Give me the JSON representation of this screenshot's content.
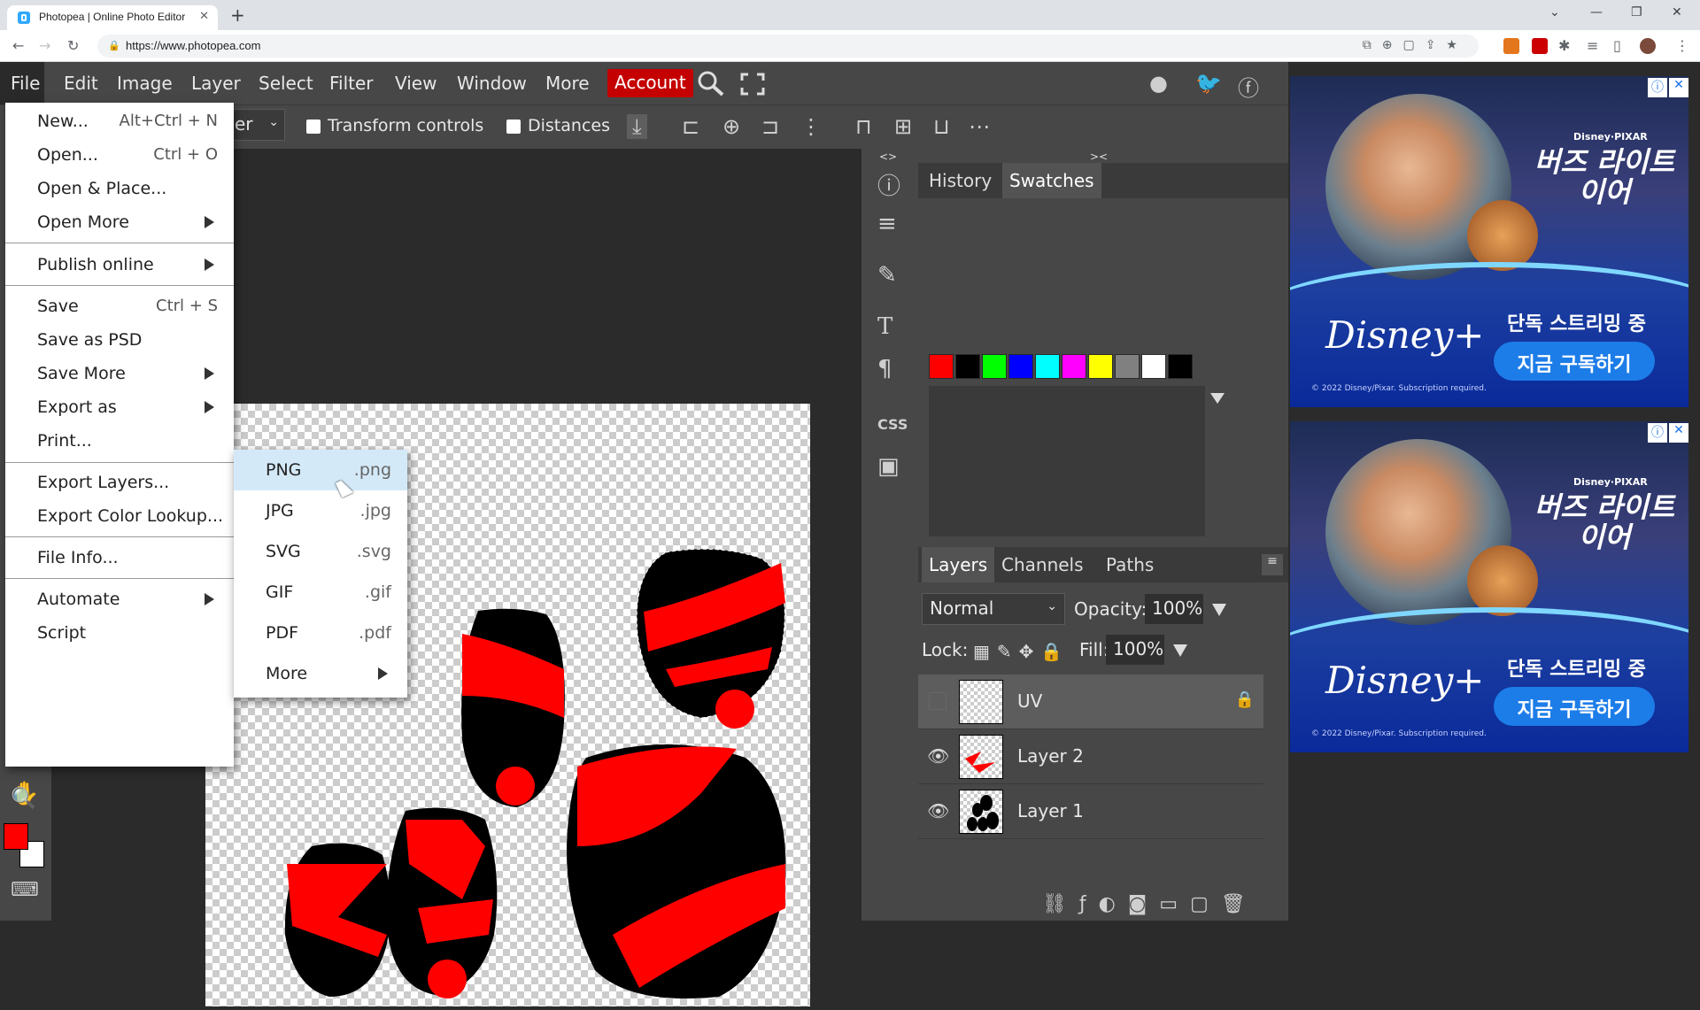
{
  "browser": {
    "tab_title": "Photopea | Online Photo Editor",
    "tab_close": "✕",
    "new_tab": "+",
    "url": "https://www.photopea.com",
    "window_controls": [
      "⌄",
      "—",
      "❐",
      "✕"
    ]
  },
  "menubar": {
    "items": [
      "File",
      "Edit",
      "Image",
      "Layer",
      "Select",
      "Filter",
      "View",
      "Window",
      "More"
    ],
    "account": "Account"
  },
  "options": {
    "select_text": "er",
    "transform_controls": "Transform controls",
    "distances": "Distances"
  },
  "file_menu": {
    "items": [
      {
        "label": "New...",
        "shortcut": "Alt+Ctrl + N"
      },
      {
        "label": "Open...",
        "shortcut": "Ctrl + O"
      },
      {
        "label": "Open & Place...",
        "shortcut": ""
      },
      {
        "label": "Open More",
        "shortcut": ""
      },
      {
        "label": "Publish online",
        "shortcut": ""
      },
      {
        "label": "Save",
        "shortcut": "Ctrl + S"
      },
      {
        "label": "Save as PSD",
        "shortcut": ""
      },
      {
        "label": "Save More",
        "shortcut": ""
      },
      {
        "label": "Export as",
        "shortcut": ""
      },
      {
        "label": "Print...",
        "shortcut": ""
      },
      {
        "label": "Export Layers...",
        "shortcut": ""
      },
      {
        "label": "Export Color Lookup...",
        "shortcut": ""
      },
      {
        "label": "File Info...",
        "shortcut": ""
      },
      {
        "label": "Automate",
        "shortcut": ""
      },
      {
        "label": "Script",
        "shortcut": ""
      }
    ]
  },
  "export_submenu": {
    "items": [
      {
        "name": "PNG",
        "ext": ".png"
      },
      {
        "name": "JPG",
        "ext": ".jpg"
      },
      {
        "name": "SVG",
        "ext": ".svg"
      },
      {
        "name": "GIF",
        "ext": ".gif"
      },
      {
        "name": "PDF",
        "ext": ".pdf"
      },
      {
        "name": "More",
        "ext": ""
      }
    ]
  },
  "panels": {
    "top_tabs": [
      "History",
      "Swatches"
    ],
    "swatch_colors": [
      "#ff0000",
      "#000000",
      "#00ff00",
      "#0000ff",
      "#00ffff",
      "#ff00ff",
      "#ffff00",
      "#808080",
      "#ffffff",
      "#000000"
    ],
    "layer_tabs": [
      "Layers",
      "Channels",
      "Paths"
    ],
    "blend_mode": "Normal",
    "opacity_label": "Opacity:",
    "opacity_value": "100%",
    "lock_label": "Lock:",
    "fill_label": "Fill:",
    "fill_value": "100%",
    "layers": [
      {
        "name": "UV",
        "visible": false,
        "locked": true
      },
      {
        "name": "Layer 2",
        "visible": true,
        "locked": false
      },
      {
        "name": "Layer 1",
        "visible": true,
        "locked": false
      }
    ],
    "side_icons": {
      "css": "CSS"
    },
    "collapse_left": "<>",
    "collapse_right": "><"
  },
  "ads": {
    "title": "버즈 라이트이어",
    "brand_small": "Disney·PIXAR",
    "logo": "Disney+",
    "stream_text": "단독 스트리밍 중",
    "button": "지금 구독하기",
    "copyright": "© 2022 Disney/Pixar. Subscription required."
  },
  "colors": {
    "foreground": "#ff0000",
    "background": "#ffffff",
    "accent": "#c40000"
  }
}
